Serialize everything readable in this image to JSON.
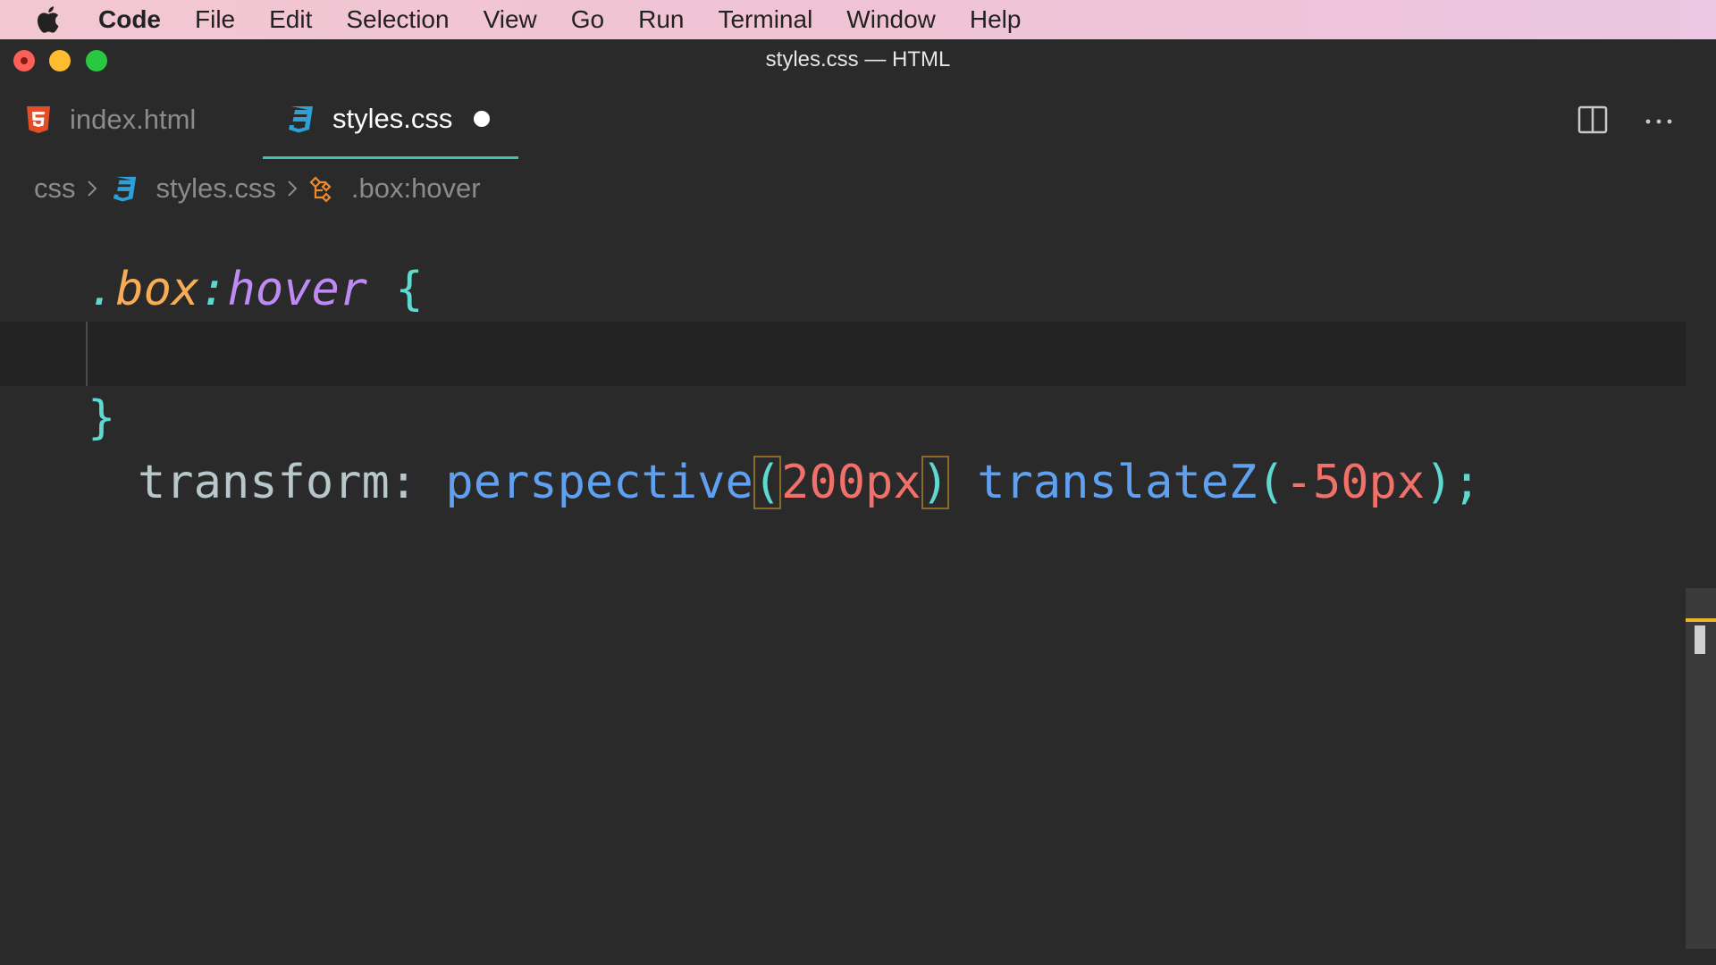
{
  "menubar": {
    "apple_icon": "apple-logo",
    "app_name": "Code",
    "items": [
      "File",
      "Edit",
      "Selection",
      "View",
      "Go",
      "Run",
      "Terminal",
      "Window",
      "Help"
    ]
  },
  "window": {
    "title": "styles.css — HTML"
  },
  "tabs": [
    {
      "label": "index.html",
      "icon": "html5-icon",
      "active": false
    },
    {
      "label": "styles.css",
      "icon": "css3-icon",
      "active": true,
      "dirty": true
    }
  ],
  "tab_actions": [
    "split-editor-icon",
    "more-actions-icon"
  ],
  "breadcrumb": {
    "folder": "css",
    "file": "styles.css",
    "symbol": ".box:hover"
  },
  "code": {
    "line1": {
      "dot": ".",
      "class": "box",
      "colon": ":",
      "pseudo": "hover",
      "brace": " {"
    },
    "line2": {
      "prop": "transform:",
      "func1": "perspective",
      "open1": "(",
      "val1": "200px",
      "close1": ")",
      "func2": "translateZ",
      "open2": "(",
      "val2": "-50px",
      "close2": ")",
      "end": ";"
    },
    "line3": {
      "brace": "}"
    }
  },
  "colors": {
    "accent": "#3fc2b4",
    "editor_bg": "#2a2a2a",
    "selector_class": "#f6ad55",
    "pseudo": "#c08af5",
    "function": "#5fa0f0",
    "number": "#f1706a"
  }
}
